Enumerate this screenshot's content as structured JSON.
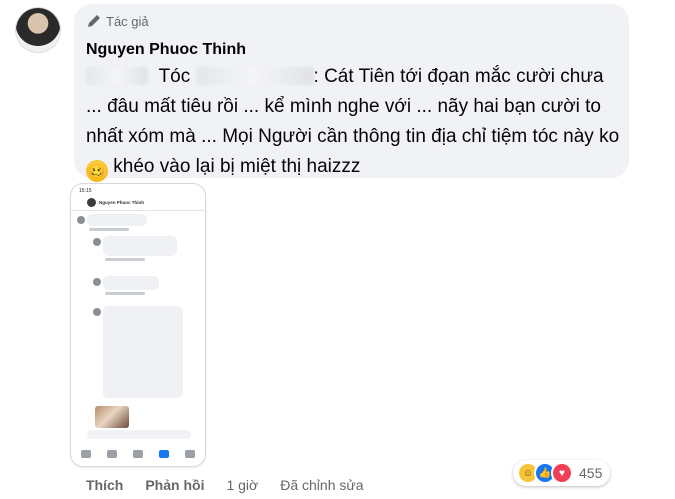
{
  "comment": {
    "role_label": "Tác giả",
    "author_name": "Nguyen Phuoc Thinh",
    "text": {
      "seg1": "Tóc",
      "seg2": ": Cát Tiên tới đọan mắc cười chưa ... đâu mất tiêu rồi ... kể mình nghe với ... nãy hai bạn cười to nhất xóm mà ... Mọi Người cần thông tin địa chỉ tiệm tóc này ko",
      "seg3": "khéo vào lại bị miệt thị haizzz"
    },
    "emoji": "🥴"
  },
  "screenshot": {
    "status_time": "15:15",
    "header_name": "Nguyen Phuoc Thinh"
  },
  "footer": {
    "like_label": "Thích",
    "reply_label": "Phản hồi",
    "time": "1 giờ",
    "edited": "Đã chỉnh sửa"
  },
  "reactions": {
    "count": "455",
    "types": [
      "haha",
      "like",
      "love"
    ]
  },
  "colors": {
    "bubble_bg": "#f0f2f5",
    "text": "#050505",
    "muted": "#65676b",
    "like_blue": "#1877f2",
    "love_red": "#f33e58",
    "haha_yellow": "#f7c53a"
  }
}
